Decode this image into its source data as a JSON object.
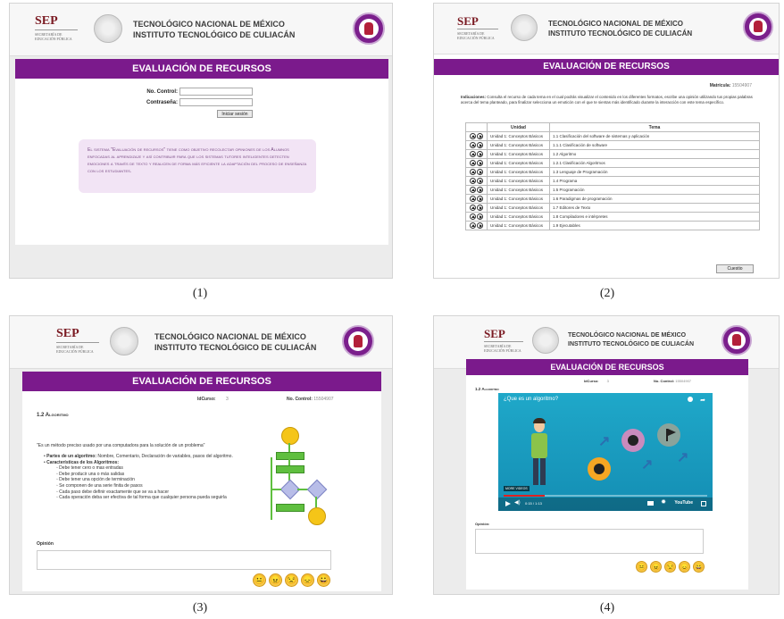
{
  "header": {
    "sep_logo": "SEP",
    "sep_sub": "SECRETARÍA DE EDUCACIÓN PÚBLICA",
    "institute_line1": "TECNOLÓGICO NACIONAL DE MÉXICO",
    "institute_line2": "INSTITUTO TECNOLÓGICO DE CULIACÁN",
    "banner": "EVALUACIÓN DE RECURSOS"
  },
  "captions": [
    "(1)",
    "(2)",
    "(3)",
    "(4)"
  ],
  "login": {
    "control_label": "No. Control:",
    "password_label": "Contraseña:",
    "submit_label": "Iniciar sesión",
    "info": "El sistema \"Evaluación de recursos\" tiene como objetivo recolectar opiniones de los Alumnos enfocadas al aprendizaje y así contribuir para que los sistemas tutores inteligentes detecten emociones a través de texto y realicen de forma más eficiente la adaptación del proceso de enseñanza con los estudiantes."
  },
  "resources": {
    "matricula_label": "Matrícula:",
    "matricula_value": "15504907",
    "indications_label": "Indicaciones:",
    "indications": "Consulta el recurso de cada tema en el cual podrás visualizar el contenido en los diferentes formatos, escribe una opinión utilizando tus propias palabras acerca del tema planteado, para finalizar selecciona un emoticón con el que te sientas más identificado durante la interacción con este tema específico.",
    "col_unidad": "Unidad",
    "col_tema": "Tema",
    "rows": [
      {
        "unidad": "Unidad 1: Conceptos Básicos",
        "tema": "1.1 Clasificación del software de sistemas y aplicación"
      },
      {
        "unidad": "Unidad 1: Conceptos Básicos",
        "tema": "1.1.1 Clasificación de software"
      },
      {
        "unidad": "Unidad 1: Conceptos Básicos",
        "tema": "1.2 Algoritmo"
      },
      {
        "unidad": "Unidad 1: Conceptos Básicos",
        "tema": "1.2.1 Clasificación Algoritmos"
      },
      {
        "unidad": "Unidad 1: Conceptos Básicos",
        "tema": "1.3 Lenguaje de Programación"
      },
      {
        "unidad": "Unidad 1: Conceptos Básicos",
        "tema": "1.4 Programa"
      },
      {
        "unidad": "Unidad 1: Conceptos Básicos",
        "tema": "1.5 Programación"
      },
      {
        "unidad": "Unidad 1: Conceptos Básicos",
        "tema": "1.6 Paradigmas de programación"
      },
      {
        "unidad": "Unidad 1: Conceptos Básicos",
        "tema": "1.7 Editores de Texto"
      },
      {
        "unidad": "Unidad 1: Conceptos Básicos",
        "tema": "1.8 Compiladores e intérpretes"
      },
      {
        "unidad": "Unidad 1: Conceptos Básicos",
        "tema": "1.9 Ejecutables"
      }
    ],
    "button": "Cuestio"
  },
  "topic": {
    "idcurso_label": "IdCurso:",
    "idcurso_value": "3",
    "control_label": "No. Control:",
    "control_value": "15504907",
    "title": "1.2 Algoritmo",
    "quote": "\"Es un método preciso usado por una computadora para la solución de un problema\"",
    "parts_label": "Partes de un algoritmo:",
    "parts_text": "Nombre, Comentario, Declaración de variables, pasos del algoritmo.",
    "chars_label": "Características de los Algoritmos:",
    "chars": [
      "Debe tener cero o mas entradas",
      "Debe producir una o más salidas",
      "Debe tener una opción de terminación",
      "Se componen de una serie finita de pasos",
      "Cada paso debe definir exactamente que se va a hacer",
      "Cada operación deba ser efectiva de tal forma que cualquier persona pueda seguirla"
    ],
    "opinion_label": "Opinión"
  },
  "video_page": {
    "idcurso_label": "IdCurso:",
    "idcurso_value": "3",
    "control_label": "No. Control:",
    "control_value": "15504907",
    "title": "1.2 Algoritmo",
    "video_title": "¿Que es un algoritmo?",
    "more_videos": "MORE VIDEOS",
    "time": "0:15 / 1:13",
    "youtube": "YouTube",
    "opinion_label": "Opinión:"
  },
  "emoticons": [
    "😐",
    "😠",
    "😒",
    "😞",
    "😀"
  ]
}
